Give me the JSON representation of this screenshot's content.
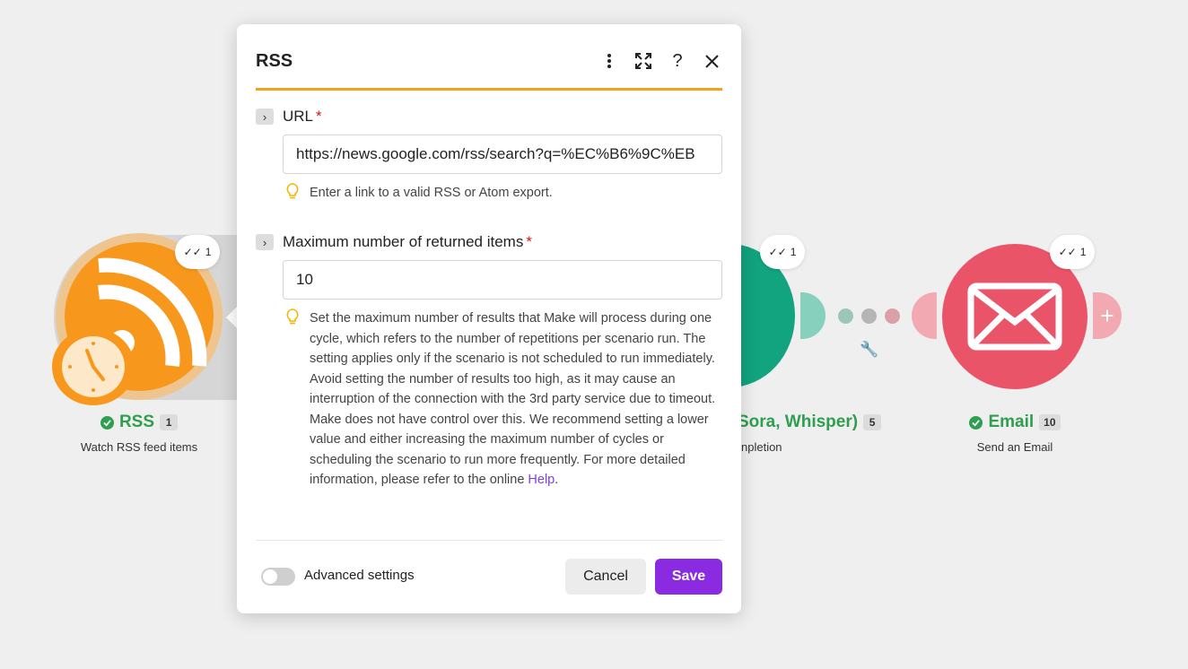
{
  "scenario": {
    "rss_module": {
      "label": "RSS",
      "count": "1",
      "subtitle": "Watch RSS feed items",
      "ops": "1",
      "color": "#f7981d"
    },
    "gpt_module": {
      "label": "Sora, Whisper)",
      "count": "5",
      "subtitle": "npletion",
      "ops": "1",
      "color": "#12a37f"
    },
    "email_module": {
      "label": "Email",
      "count": "10",
      "subtitle": "Send an Email",
      "ops": "1",
      "color": "#ea5468"
    },
    "connector_dots": [
      "#9cc7b8",
      "#b5b5b5",
      "#d9a0a8"
    ],
    "add_label": "+"
  },
  "modal": {
    "title": "RSS",
    "icons": [
      "more-vertical-icon",
      "expand-icon",
      "help-icon",
      "close-icon"
    ],
    "accent": "#f7a11a",
    "fields": {
      "url": {
        "label": "URL",
        "required_mark": "*",
        "value": "https://news.google.com/rss/search?q=%EC%B6%9C%EB",
        "hint": "Enter a link to a valid RSS or Atom export."
      },
      "max_items": {
        "label": "Maximum number of returned items",
        "required_mark": "*",
        "value": "10",
        "hint": "Set the maximum number of results that Make will process during one cycle, which refers to the number of repetitions per scenario run. The setting applies only if the scenario is not scheduled to run immediately. Avoid setting the number of results too high, as it may cause an interruption of the connection with the 3rd party service due to timeout. Make does not have control over this. We recommend setting a lower value and either increasing the maximum number of cycles or scheduling the scenario to run more frequently. For more detailed information, please refer to the online ",
        "hint_link": "Help",
        "hint_end": "."
      }
    },
    "footer": {
      "advanced_label": "Advanced settings",
      "advanced_on": false,
      "cancel_label": "Cancel",
      "save_label": "Save",
      "save_color": "#8a2be2"
    }
  }
}
